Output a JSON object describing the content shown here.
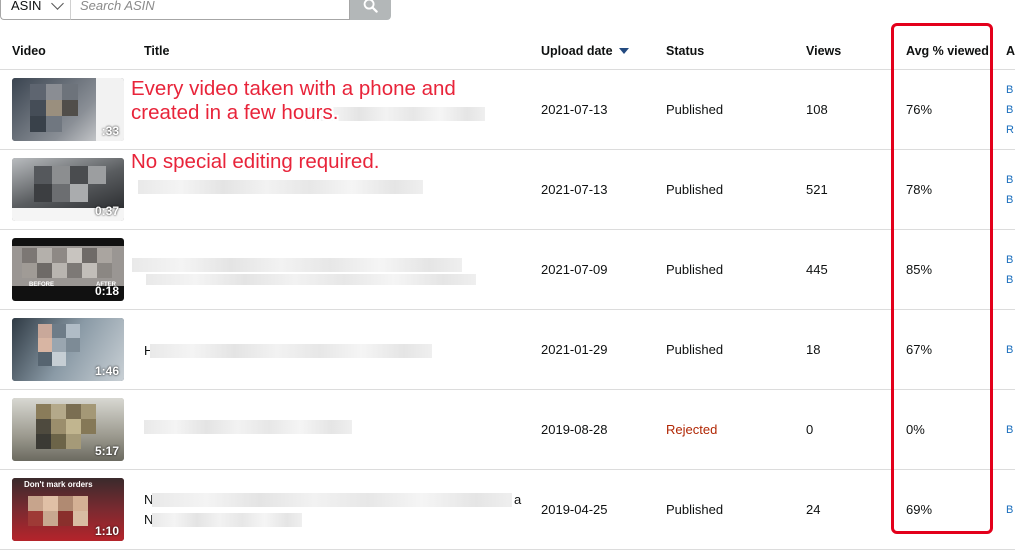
{
  "search": {
    "select_value": "ASIN",
    "placeholder": "Search ASIN"
  },
  "columns": {
    "video": "Video",
    "title": "Title",
    "upload_date": "Upload date",
    "status": "Status",
    "views": "Views",
    "avg_viewed": "Avg % viewed",
    "actions": "A"
  },
  "annotations": {
    "line1": "Every video taken with a phone and",
    "line2": "created in a few hours.",
    "line3": "No special editing required."
  },
  "rows": [
    {
      "duration": ":33",
      "title_prefix": "",
      "title_suffix": "",
      "date": "2021-07-13",
      "status": "Published",
      "views": "108",
      "avg": "76%",
      "links": [
        "B",
        "B",
        "R"
      ]
    },
    {
      "duration": "0:37",
      "title_prefix": "",
      "title_suffix": "",
      "date": "2021-07-13",
      "status": "Published",
      "views": "521",
      "avg": "78%",
      "links": [
        "B",
        "B"
      ]
    },
    {
      "duration": "0:18",
      "title_prefix": "",
      "title_suffix": "",
      "date": "2021-07-09",
      "status": "Published",
      "views": "445",
      "avg": "85%",
      "links": [
        "B",
        "B"
      ]
    },
    {
      "duration": "1:46",
      "title_prefix": "H",
      "title_suffix": "",
      "date": "2021-01-29",
      "status": "Published",
      "views": "18",
      "avg": "67%",
      "links": [
        "B"
      ]
    },
    {
      "duration": "5:17",
      "title_prefix": "",
      "title_suffix": "",
      "date": "2019-08-28",
      "status": "Rejected",
      "views": "0",
      "avg": "0%",
      "links": [
        "B"
      ]
    },
    {
      "duration": "1:10",
      "title_prefix": "N",
      "title_suffix": "a",
      "date": "2019-04-25",
      "status": "Published",
      "views": "24",
      "avg": "69%",
      "links": [
        "B"
      ]
    }
  ],
  "thumb_text": {
    "row3_left": "BEFORE",
    "row3_right": "AFTER",
    "row6_top": "Don't mark orders"
  },
  "colors": {
    "accent_red": "#e3001b",
    "link_blue": "#1a6ebd",
    "rejected": "#b12704"
  }
}
